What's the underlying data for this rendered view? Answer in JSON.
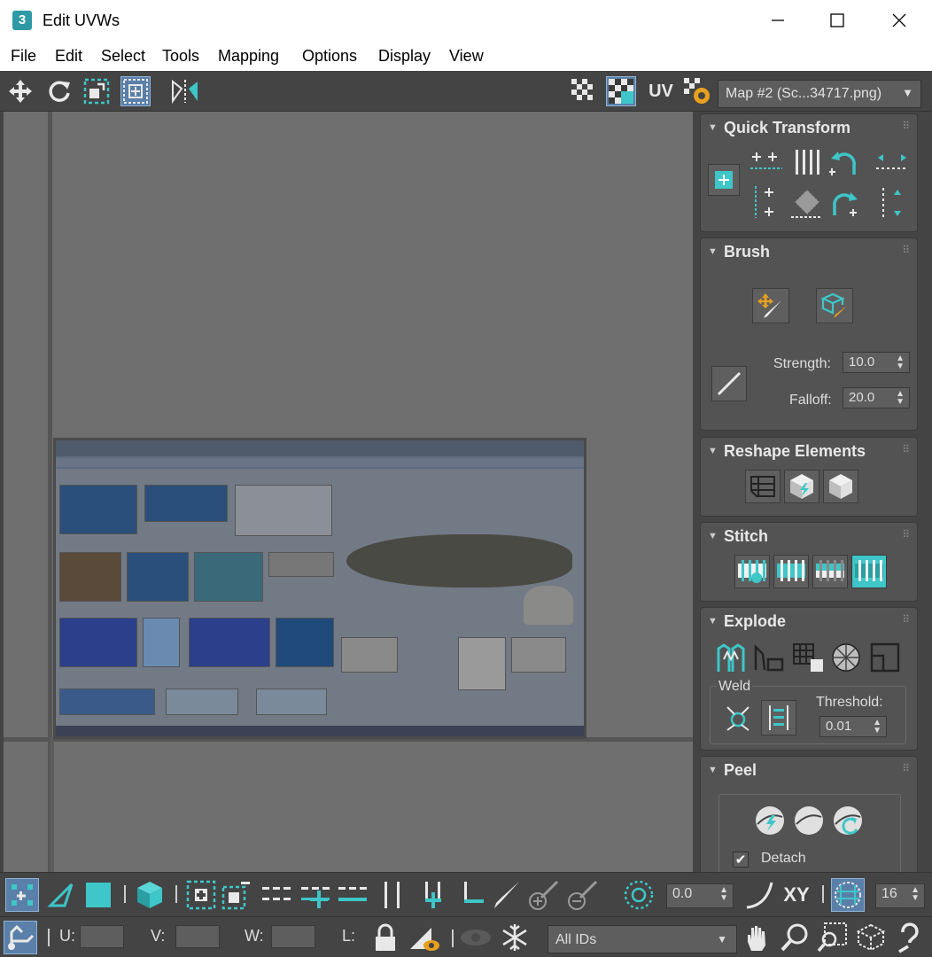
{
  "window": {
    "title": "Edit UVWs",
    "app_icon_label": "3"
  },
  "menu": [
    "File",
    "Edit",
    "Select",
    "Tools",
    "Mapping",
    "Options",
    "Display",
    "View"
  ],
  "toolbar": {
    "uv_label": "UV",
    "map_selector": "Map #2 (Sc...34717.png)"
  },
  "rollouts": {
    "quick_transform": {
      "title": "Quick Transform"
    },
    "brush": {
      "title": "Brush",
      "strength_label": "Strength:",
      "strength_value": "10.0",
      "falloff_label": "Falloff:",
      "falloff_value": "20.0"
    },
    "reshape": {
      "title": "Reshape Elements"
    },
    "stitch": {
      "title": "Stitch"
    },
    "explode": {
      "title": "Explode",
      "weld_label": "Weld",
      "threshold_label": "Threshold:",
      "threshold_value": "0.01"
    },
    "peel": {
      "title": "Peel",
      "detach_label": "Detach",
      "detach_checked": true
    }
  },
  "bottom": {
    "angle_value": "0.0",
    "xy_label": "XY",
    "grid_value": "16",
    "u_label": "U:",
    "v_label": "V:",
    "w_label": "W:",
    "l_label": "L:",
    "ids_selector": "All IDs"
  },
  "colors": {
    "accent": "#3ec6c8",
    "active_bg": "#5a7fa8",
    "panel": "#535353",
    "viewport": "#6f6f6f"
  }
}
